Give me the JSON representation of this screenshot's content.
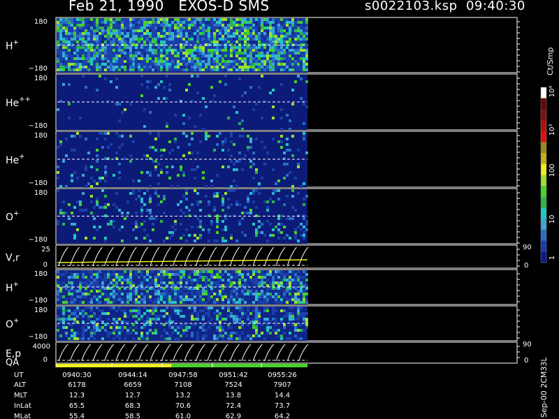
{
  "header": {
    "date": "Feb 21, 1990",
    "mission": "EXOS-D SMS",
    "file": "s0022103.ksp",
    "time": "09:40:30"
  },
  "colorbar": {
    "unit": "Ct/Smp",
    "tick_labels": [
      "1",
      "10",
      "100",
      "10³",
      "10⁴"
    ],
    "colors": [
      "#0a1a8c",
      "#1c3cb0",
      "#2a6cc8",
      "#39a8d4",
      "#20c8c0",
      "#2ab54a",
      "#48d22a",
      "#9ce030",
      "#f0f020",
      "#c8b018",
      "#9a8a16",
      "#e01010",
      "#b01010",
      "#801010",
      "#600808",
      "#ffffff"
    ]
  },
  "footer_note": "Sep-00 2CM33L",
  "panels": [
    {
      "id": "h-plus",
      "label": "H",
      "sup": "+",
      "ymax": "180",
      "ymin": "−180",
      "type": "spectrogram",
      "base": "#112a8c",
      "activity": 0.9
    },
    {
      "id": "he-plus-plus",
      "label": "He",
      "sup": "++",
      "ymax": "180",
      "ymin": "−180",
      "type": "spectrogram",
      "base": "#0c1b78",
      "activity": 0.05
    },
    {
      "id": "he-plus",
      "label": "He",
      "sup": "+",
      "ymax": "180",
      "ymin": "−180",
      "type": "spectrogram",
      "base": "#0c1b78",
      "activity": 0.12
    },
    {
      "id": "o-plus",
      "label": "O",
      "sup": "+",
      "ymax": "180",
      "ymin": "−180",
      "type": "spectrogram",
      "base": "#0c1b78",
      "activity": 0.18
    },
    {
      "id": "v-r",
      "label": "V,r",
      "sup": "",
      "ymax": "25",
      "ymin": "0",
      "type": "line",
      "right_max": "90",
      "right_min": "0"
    },
    {
      "id": "h-plus-2",
      "label": "H",
      "sup": "+",
      "ymax": "180",
      "ymin": "−180",
      "type": "spectrogram",
      "base": "#112a8c",
      "activity": 0.6
    },
    {
      "id": "o-plus-2",
      "label": "O",
      "sup": "+",
      "ymax": "180",
      "ymin": "−180",
      "type": "spectrogram",
      "base": "#0f2486",
      "activity": 0.45
    },
    {
      "id": "e-p",
      "label": "E,p",
      "sup": "",
      "ymax": "4000",
      "ymin": "0",
      "type": "line",
      "right_max": "90",
      "right_min": "0"
    }
  ],
  "qa": {
    "label": "QA",
    "segments": [
      {
        "color": "#f0f020",
        "frac": 0.46
      },
      {
        "color": "#48d22a",
        "frac": 0.54
      }
    ]
  },
  "table": {
    "row_labels": [
      "UT",
      "ALT",
      "MLT",
      "InLat",
      "MLat"
    ],
    "columns": [
      [
        "0940:30",
        "6178",
        "12.3",
        "65.5",
        "55.4"
      ],
      [
        "0944:14",
        "6659",
        "12.7",
        "68.3",
        "58.5"
      ],
      [
        "0947:58",
        "7108",
        "13.2",
        "70.6",
        "61.0"
      ],
      [
        "0951:42",
        "7524",
        "13.8",
        "72.4",
        "62.9"
      ],
      [
        "0955:26",
        "7907",
        "14.4",
        "73.7",
        "64.2"
      ]
    ]
  },
  "chart_data": {
    "type": "heatmap",
    "title": "Feb 21, 1990   EXOS-D SMS",
    "x_ticks": [
      "0940:30",
      "0944:14",
      "0947:58",
      "0951:42",
      "0955:26"
    ],
    "panels": [
      "H+",
      "He++",
      "He+",
      "O+",
      "V,r",
      "H+",
      "O+",
      "E,p"
    ],
    "colorbar_range": [
      1,
      10000
    ],
    "colorbar_scale": "log",
    "colorbar_unit": "Ct/Smp"
  }
}
